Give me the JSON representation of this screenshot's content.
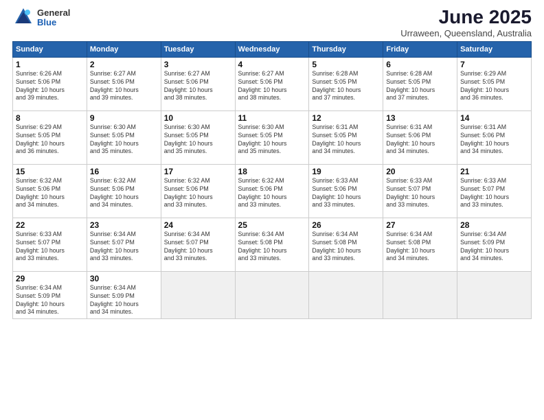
{
  "logo": {
    "general": "General",
    "blue": "Blue"
  },
  "title": "June 2025",
  "location": "Urraween, Queensland, Australia",
  "weekdays": [
    "Sunday",
    "Monday",
    "Tuesday",
    "Wednesday",
    "Thursday",
    "Friday",
    "Saturday"
  ],
  "weeks": [
    [
      {
        "day": "1",
        "info": "Sunrise: 6:26 AM\nSunset: 5:06 PM\nDaylight: 10 hours\nand 39 minutes."
      },
      {
        "day": "2",
        "info": "Sunrise: 6:27 AM\nSunset: 5:06 PM\nDaylight: 10 hours\nand 39 minutes."
      },
      {
        "day": "3",
        "info": "Sunrise: 6:27 AM\nSunset: 5:06 PM\nDaylight: 10 hours\nand 38 minutes."
      },
      {
        "day": "4",
        "info": "Sunrise: 6:27 AM\nSunset: 5:06 PM\nDaylight: 10 hours\nand 38 minutes."
      },
      {
        "day": "5",
        "info": "Sunrise: 6:28 AM\nSunset: 5:05 PM\nDaylight: 10 hours\nand 37 minutes."
      },
      {
        "day": "6",
        "info": "Sunrise: 6:28 AM\nSunset: 5:05 PM\nDaylight: 10 hours\nand 37 minutes."
      },
      {
        "day": "7",
        "info": "Sunrise: 6:29 AM\nSunset: 5:05 PM\nDaylight: 10 hours\nand 36 minutes."
      }
    ],
    [
      {
        "day": "8",
        "info": "Sunrise: 6:29 AM\nSunset: 5:05 PM\nDaylight: 10 hours\nand 36 minutes."
      },
      {
        "day": "9",
        "info": "Sunrise: 6:30 AM\nSunset: 5:05 PM\nDaylight: 10 hours\nand 35 minutes."
      },
      {
        "day": "10",
        "info": "Sunrise: 6:30 AM\nSunset: 5:05 PM\nDaylight: 10 hours\nand 35 minutes."
      },
      {
        "day": "11",
        "info": "Sunrise: 6:30 AM\nSunset: 5:05 PM\nDaylight: 10 hours\nand 35 minutes."
      },
      {
        "day": "12",
        "info": "Sunrise: 6:31 AM\nSunset: 5:05 PM\nDaylight: 10 hours\nand 34 minutes."
      },
      {
        "day": "13",
        "info": "Sunrise: 6:31 AM\nSunset: 5:06 PM\nDaylight: 10 hours\nand 34 minutes."
      },
      {
        "day": "14",
        "info": "Sunrise: 6:31 AM\nSunset: 5:06 PM\nDaylight: 10 hours\nand 34 minutes."
      }
    ],
    [
      {
        "day": "15",
        "info": "Sunrise: 6:32 AM\nSunset: 5:06 PM\nDaylight: 10 hours\nand 34 minutes."
      },
      {
        "day": "16",
        "info": "Sunrise: 6:32 AM\nSunset: 5:06 PM\nDaylight: 10 hours\nand 34 minutes."
      },
      {
        "day": "17",
        "info": "Sunrise: 6:32 AM\nSunset: 5:06 PM\nDaylight: 10 hours\nand 33 minutes."
      },
      {
        "day": "18",
        "info": "Sunrise: 6:32 AM\nSunset: 5:06 PM\nDaylight: 10 hours\nand 33 minutes."
      },
      {
        "day": "19",
        "info": "Sunrise: 6:33 AM\nSunset: 5:06 PM\nDaylight: 10 hours\nand 33 minutes."
      },
      {
        "day": "20",
        "info": "Sunrise: 6:33 AM\nSunset: 5:07 PM\nDaylight: 10 hours\nand 33 minutes."
      },
      {
        "day": "21",
        "info": "Sunrise: 6:33 AM\nSunset: 5:07 PM\nDaylight: 10 hours\nand 33 minutes."
      }
    ],
    [
      {
        "day": "22",
        "info": "Sunrise: 6:33 AM\nSunset: 5:07 PM\nDaylight: 10 hours\nand 33 minutes."
      },
      {
        "day": "23",
        "info": "Sunrise: 6:34 AM\nSunset: 5:07 PM\nDaylight: 10 hours\nand 33 minutes."
      },
      {
        "day": "24",
        "info": "Sunrise: 6:34 AM\nSunset: 5:07 PM\nDaylight: 10 hours\nand 33 minutes."
      },
      {
        "day": "25",
        "info": "Sunrise: 6:34 AM\nSunset: 5:08 PM\nDaylight: 10 hours\nand 33 minutes."
      },
      {
        "day": "26",
        "info": "Sunrise: 6:34 AM\nSunset: 5:08 PM\nDaylight: 10 hours\nand 33 minutes."
      },
      {
        "day": "27",
        "info": "Sunrise: 6:34 AM\nSunset: 5:08 PM\nDaylight: 10 hours\nand 34 minutes."
      },
      {
        "day": "28",
        "info": "Sunrise: 6:34 AM\nSunset: 5:09 PM\nDaylight: 10 hours\nand 34 minutes."
      }
    ],
    [
      {
        "day": "29",
        "info": "Sunrise: 6:34 AM\nSunset: 5:09 PM\nDaylight: 10 hours\nand 34 minutes."
      },
      {
        "day": "30",
        "info": "Sunrise: 6:34 AM\nSunset: 5:09 PM\nDaylight: 10 hours\nand 34 minutes."
      },
      {
        "day": "",
        "info": ""
      },
      {
        "day": "",
        "info": ""
      },
      {
        "day": "",
        "info": ""
      },
      {
        "day": "",
        "info": ""
      },
      {
        "day": "",
        "info": ""
      }
    ]
  ]
}
